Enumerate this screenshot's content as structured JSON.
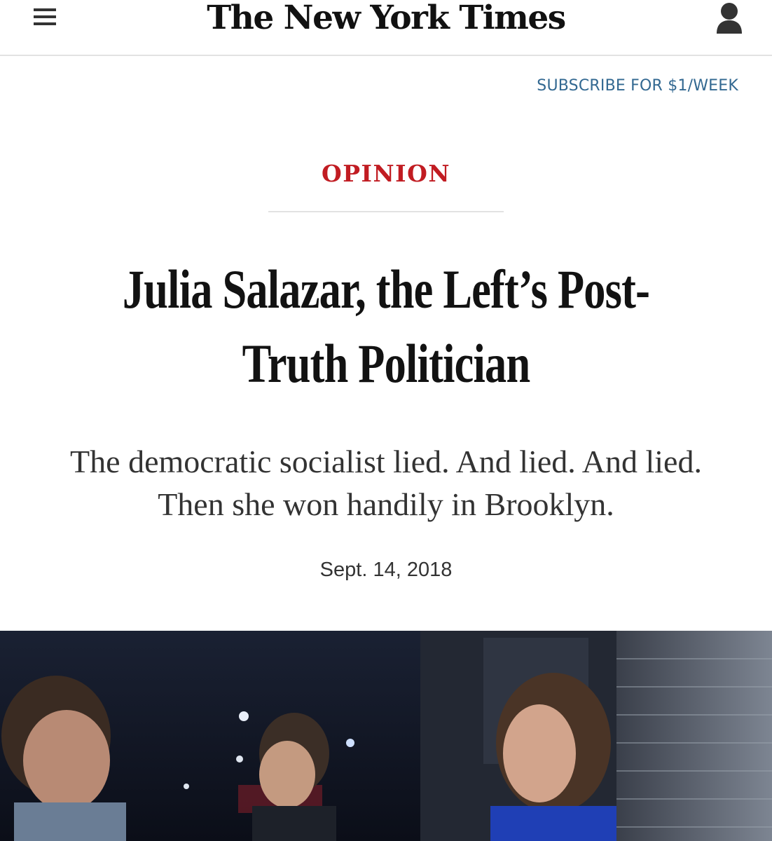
{
  "header": {
    "logo_text": "The New York Times",
    "menu_icon": "hamburger-menu-icon",
    "account_icon": "user-account-icon"
  },
  "subscribe": {
    "label": "SUBSCRIBE FOR $1/WEEK"
  },
  "article": {
    "section": "OPINION",
    "headline": "Julia Salazar, the Left’s Post-Truth Politician",
    "summary": "The democratic socialist lied. And lied. And lied. Then she won handily in Brooklyn.",
    "date": "Sept. 14, 2018"
  },
  "colors": {
    "section": "#c11c22",
    "link": "#326891",
    "text": "#121212",
    "divider": "#e2e2e2"
  }
}
